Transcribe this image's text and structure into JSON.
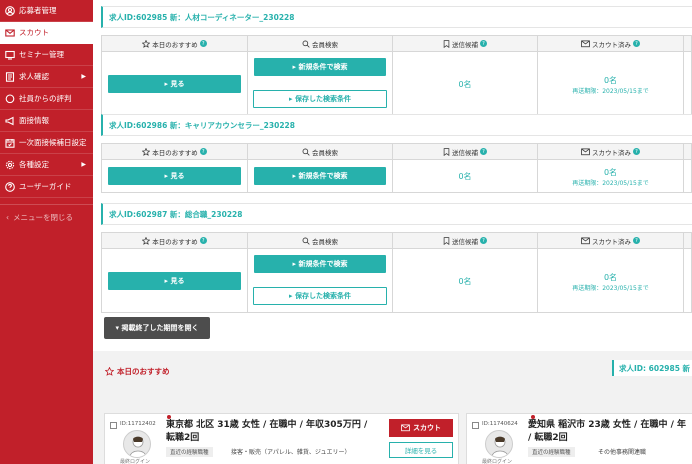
{
  "sidebar": {
    "items": [
      {
        "label": "応募者管理",
        "icon": "person-circle-icon",
        "active": false,
        "arrow": ""
      },
      {
        "label": "スカウト",
        "icon": "envelope-icon",
        "active": true,
        "arrow": ""
      },
      {
        "label": "セミナー管理",
        "icon": "screen-icon",
        "active": false,
        "arrow": ""
      },
      {
        "label": "求人確認",
        "icon": "document-icon",
        "active": false,
        "arrow": "▶"
      },
      {
        "label": "社員からの評判",
        "icon": "chat-icon",
        "active": false,
        "arrow": ""
      },
      {
        "label": "面接情報",
        "icon": "megaphone-icon",
        "active": false,
        "arrow": ""
      },
      {
        "label": "一次面接候補日設定",
        "icon": "calendar-icon",
        "active": false,
        "arrow": ""
      },
      {
        "label": "各種設定",
        "icon": "gear-icon",
        "active": false,
        "arrow": "▶"
      },
      {
        "label": "ユーザーガイド",
        "icon": "question-icon",
        "active": false,
        "arrow": ""
      }
    ],
    "collapse_label": "メニューを閉じる"
  },
  "table_headers": {
    "today": "本日のおすすめ",
    "search": "会員検索",
    "pending": "送信候補",
    "sent": "スカウト済み",
    "help": "?"
  },
  "jobs": [
    {
      "title": "求人ID:602985 新：人材コーディネーター_230228",
      "view_label": "▸ 見る",
      "new_search_label": "▸ 新規条件で検索",
      "saved_search_label": "▸ 保存した検索条件",
      "pending_count": "0名",
      "sent_count": "0名",
      "deadline": "再送期限：2023/05/15まで"
    },
    {
      "title": "求人ID:602986 新：キャリアカウンセラー_230228",
      "view_label": "▸ 見る",
      "new_search_label": "▸ 新規条件で検索",
      "saved_search_label": "",
      "pending_count": "0名",
      "sent_count": "0名",
      "deadline": "再送期限：2023/05/15まで"
    },
    {
      "title": "求人ID:602987 新：総合職_230228",
      "view_label": "▸ 見る",
      "new_search_label": "▸ 新規条件で検索",
      "saved_search_label": "▸ 保存した検索条件",
      "pending_count": "0名",
      "sent_count": "0名",
      "deadline": "再送期限：2023/05/15まで"
    }
  ],
  "closed_button": "▾ 掲載終了した期間を開く",
  "recommend": {
    "title": "本日のおすすめ",
    "job_label": "求人ID: 602985 新",
    "cards": [
      {
        "id": "ID:11712402",
        "profile_line1": "東京都 北区 31歳 女性 / 在職中 / 年収305万円 /",
        "profile_line2": "転職2回",
        "tag": "直近の経験職種",
        "industry": "接客・販売（アパレル、雑貨、ジュエリー）",
        "login": "最終ログイン",
        "scout_label": "スカウト",
        "detail_label": "詳細を見る"
      },
      {
        "id": "ID:11740624",
        "profile_line1": "愛知県 稲沢市 23歳 女性 / 在職中 / 年",
        "profile_line2": "/ 転職2回",
        "tag": "直近の経験職種",
        "industry": "その他事務関連職",
        "login": "最終ログイン",
        "scout_label": "",
        "detail_label": ""
      }
    ]
  },
  "colors": {
    "brand_red": "#c1202a",
    "teal": "#27b1ac"
  }
}
